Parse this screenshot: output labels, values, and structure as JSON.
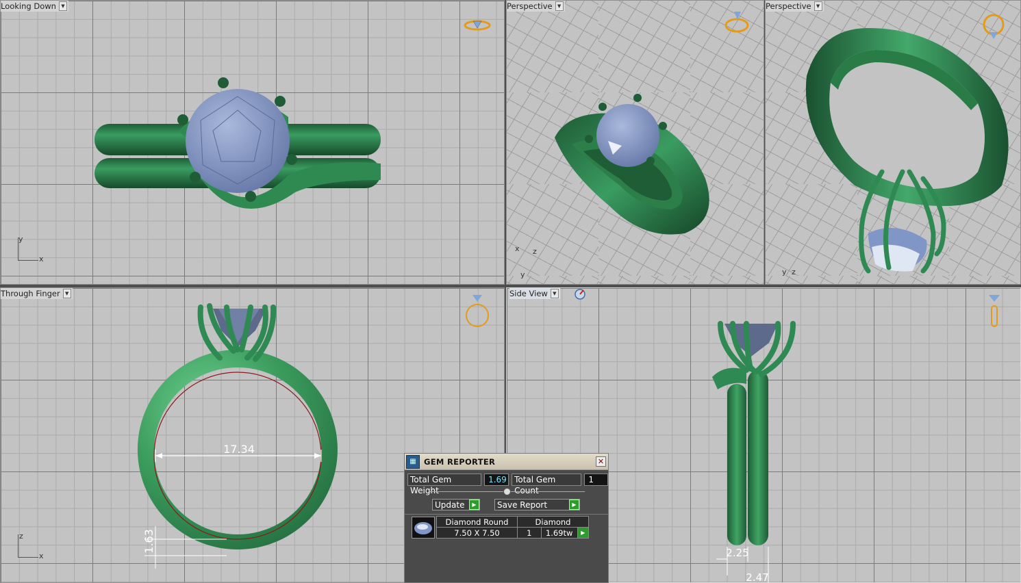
{
  "viewports": {
    "top": {
      "label": "Looking Down",
      "axis_v": "y",
      "axis_h": "x"
    },
    "persp1": {
      "label": "Perspective",
      "axis_a": "x",
      "axis_b": "z",
      "axis_c": "y"
    },
    "persp2": {
      "label": "Perspective",
      "axis_a": "y",
      "axis_b": "z"
    },
    "front": {
      "label": "Through Finger",
      "axis_v": "z",
      "axis_h": "x",
      "dim_inner": "17.34",
      "dim_thickness": "1.63"
    },
    "side": {
      "label": "Side View",
      "dim_width": "2.25",
      "dim_total": "2.47"
    }
  },
  "gem_reporter": {
    "title": "GEM REPORTER",
    "total_weight_label": "Total Gem Weight",
    "total_weight_value": "1.69",
    "total_count_label": "Total Gem Count",
    "total_count_value": "1",
    "update_label": "Update",
    "save_label": "Save Report",
    "gem": {
      "shape": "Diamond Round",
      "size": "7.50 X 7.50",
      "type": "Diamond",
      "count": "1",
      "weight": "1.69tw"
    }
  },
  "colors": {
    "ring": "#2e8a4e",
    "gem": "#7f96c6",
    "grid_bg": "#c3c3c3",
    "nav_icon": "#e59b1a"
  }
}
